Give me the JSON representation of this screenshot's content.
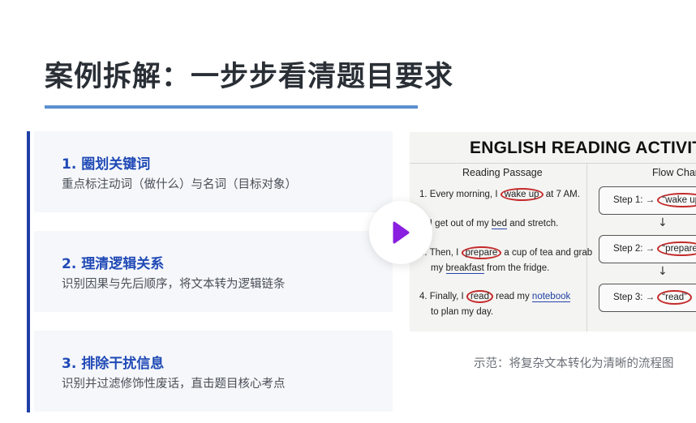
{
  "title": "案例拆解：一步步看清题目要求",
  "cards": [
    {
      "heading": "1. 圈划关键词",
      "desc": "重点标注动词（做什么）与名词（目标对象）"
    },
    {
      "heading": "2. 理清逻辑关系",
      "desc": "识别因果与先后顺序，将文本转为逻辑链条"
    },
    {
      "heading": "3. 排除干扰信息",
      "desc": "识别并过滤修饰性废话，直击题目核心考点"
    }
  ],
  "worksheet": {
    "title": "ENGLISH READING ACTIVITY",
    "reading_head": "Reading Passage",
    "flow_head": "Flow Chart",
    "lines": {
      "l1a": "1. Every morning, I ",
      "l1b": "wake up",
      "l1c": " at 7 AM.",
      "l2a": "2. I get out of my ",
      "l2b": "bed",
      "l2c": " and stretch.",
      "l3a": "3. Then, I ",
      "l3b": "prepare",
      "l3c": " a cup of tea and grab",
      "l4a": "my ",
      "l4b": "breakfast",
      "l4c": " from the fridge.",
      "l5a": "4. Finally, I ",
      "l5b": "read",
      "l5c": " read my ",
      "l5d": "notebook",
      "l6a": "to plan my day."
    },
    "steps": [
      {
        "label": "Step 1: → ",
        "word": "“wake up”"
      },
      {
        "label": "Step 2: → ",
        "word": "“prepare”"
      },
      {
        "label": "Step 3: → ",
        "word": "“read”"
      }
    ],
    "arrow": "↓"
  },
  "caption": "示范：将复杂文本转化为清晰的流程图",
  "colors": {
    "accent": "#1f49b6",
    "rule": "#5b8fd0",
    "play": "#8a1fe0",
    "circle": "#c42a2a"
  },
  "icons": {
    "play": "play-icon"
  }
}
